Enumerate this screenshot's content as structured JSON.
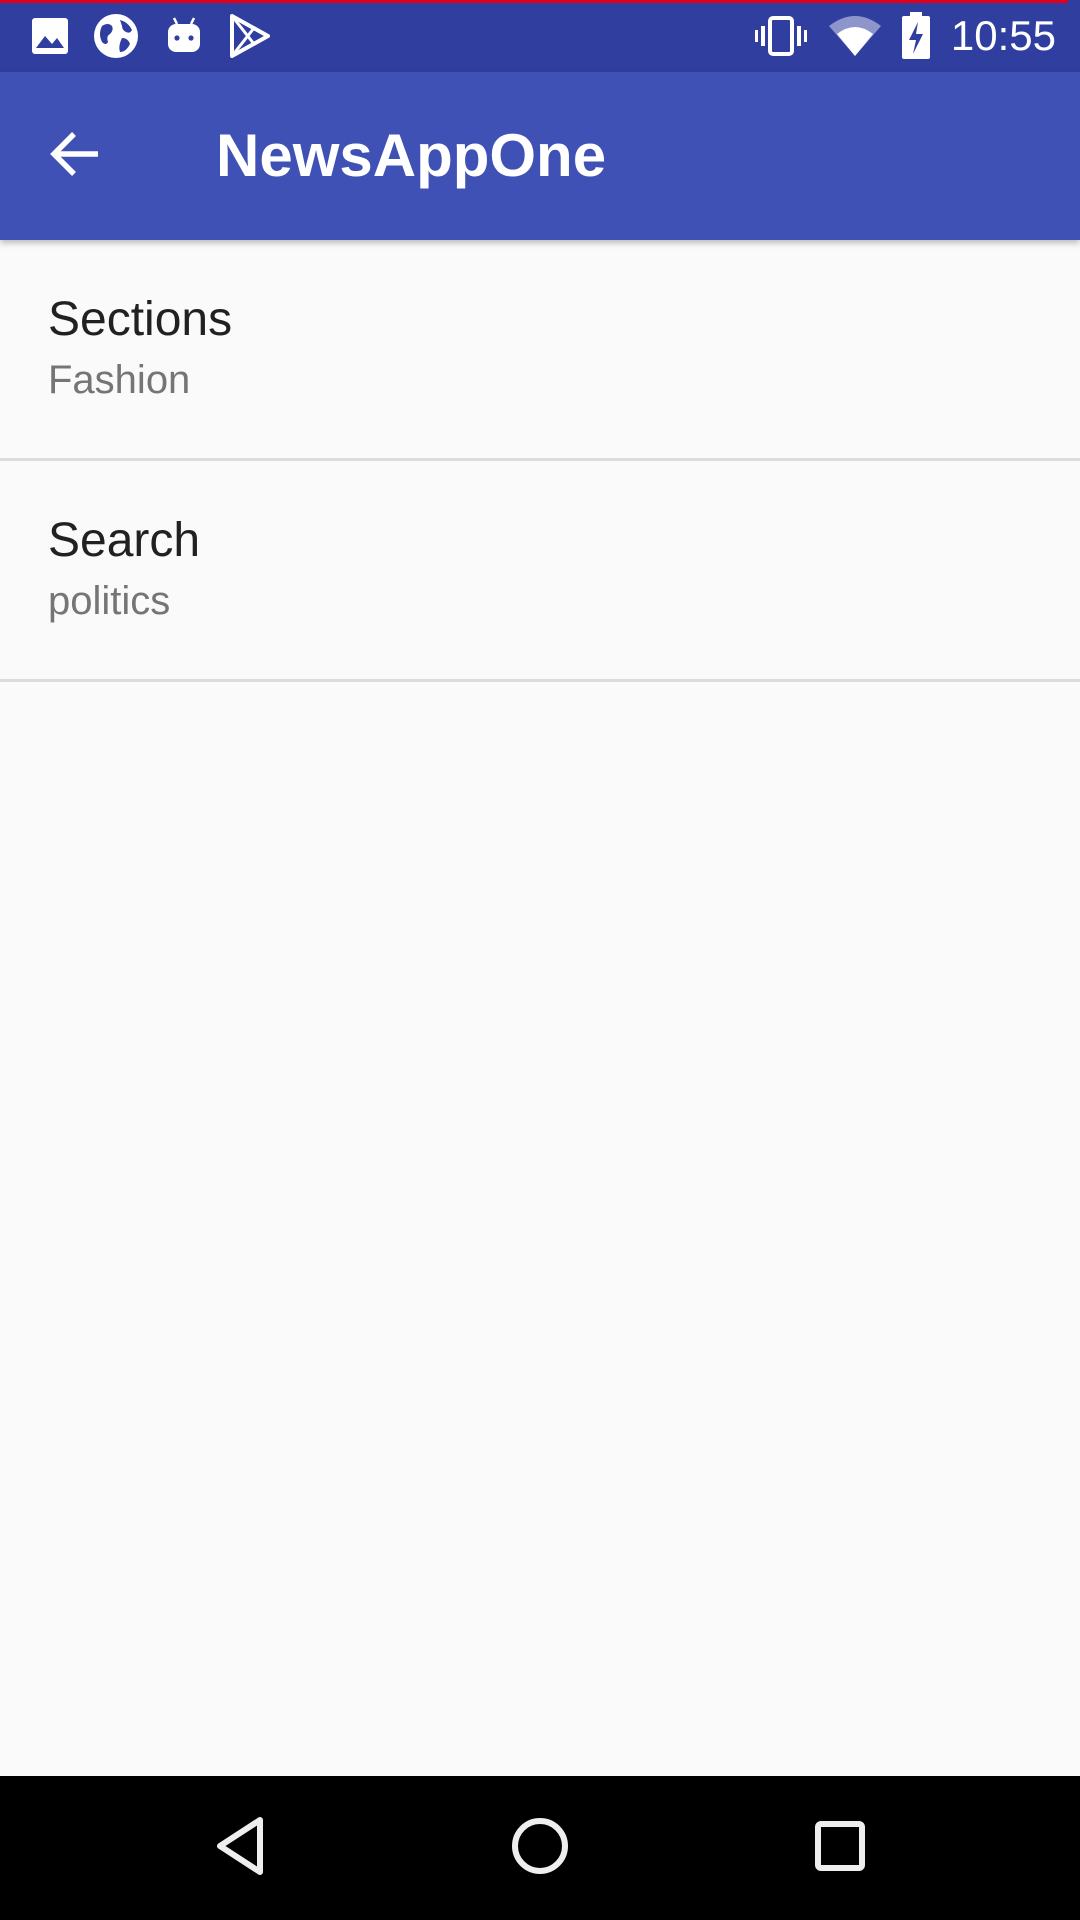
{
  "status_bar": {
    "time": "10:55",
    "left_icons": [
      "image-icon",
      "globe-icon",
      "android-icon",
      "play-store-icon"
    ],
    "right_icons": [
      "vibrate-icon",
      "wifi-icon",
      "battery-charging-icon"
    ],
    "background_color": "#303F9F",
    "accent_line_color": "#E0001B"
  },
  "app_bar": {
    "title": "NewsAppOne",
    "back_icon": "arrow-back-icon",
    "background_color": "#3F51B5"
  },
  "preferences": [
    {
      "title": "Sections",
      "summary": "Fashion"
    },
    {
      "title": "Search",
      "summary": "politics"
    }
  ],
  "nav_bar": {
    "buttons": [
      "back-triangle-icon",
      "home-circle-icon",
      "recents-square-icon"
    ]
  }
}
